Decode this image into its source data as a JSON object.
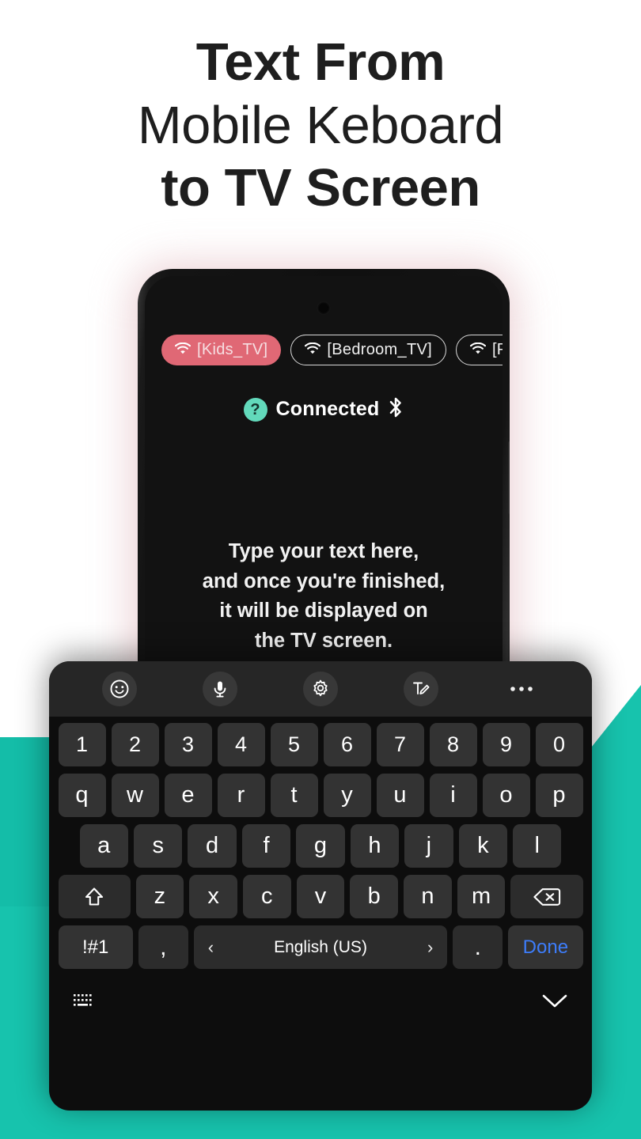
{
  "headline": {
    "line1": "Text From",
    "line2": "Mobile Keboard",
    "line3": "to TV Screen"
  },
  "colors": {
    "background": "#ffffff",
    "teal": "#17c3ad",
    "teal_dark": "#0fb8a3",
    "active_chip": "#e06875",
    "phone_glow": "#e8c9cd",
    "screen": "#121212",
    "keyboard_bg": "#0d0d0d",
    "key": "#333333",
    "toolbar": "#262626",
    "done_blue": "#3d7dfb",
    "badge_teal": "#62d9bb"
  },
  "phone": {
    "chips": [
      {
        "label": "[Kids_TV]",
        "state": "active",
        "icon": "wifi-icon"
      },
      {
        "label": "[Bedroom_TV]",
        "state": "idle",
        "icon": "wifi-icon"
      },
      {
        "label": "[Pa",
        "state": "idle",
        "icon": "wifi-icon"
      }
    ],
    "status": {
      "badge": "?",
      "text": "Connected",
      "bluetooth_icon": "bluetooth-icon"
    },
    "placeholder_lines": [
      "Type your text here,",
      "and once you're finished,",
      "it will be displayed on",
      "the TV screen."
    ]
  },
  "keyboard": {
    "toolbar": [
      {
        "name": "emoji-icon",
        "label": "emoji"
      },
      {
        "name": "microphone-icon",
        "label": "voice input"
      },
      {
        "name": "gear-icon",
        "label": "settings"
      },
      {
        "name": "handwriting-icon",
        "label": "handwriting"
      },
      {
        "name": "more-icon",
        "label": "more options"
      }
    ],
    "rows": {
      "numbers": [
        "1",
        "2",
        "3",
        "4",
        "5",
        "6",
        "7",
        "8",
        "9",
        "0"
      ],
      "letters1": [
        "q",
        "w",
        "e",
        "r",
        "t",
        "y",
        "u",
        "i",
        "o",
        "p"
      ],
      "letters2": [
        "a",
        "s",
        "d",
        "f",
        "g",
        "h",
        "j",
        "k",
        "l"
      ],
      "letters3": [
        "z",
        "x",
        "c",
        "v",
        "b",
        "n",
        "m"
      ]
    },
    "shift_key": "shift-icon",
    "backspace_key": "backspace-icon",
    "bottom_row": {
      "symbols": "!#1",
      "comma": ",",
      "space_prev": "‹",
      "space_label": "English (US)",
      "space_next": "›",
      "period": ".",
      "done": "Done"
    },
    "bottom_bar": {
      "keyboard_switch": "keyboard-icon",
      "hide": "chevron-down-icon"
    }
  }
}
